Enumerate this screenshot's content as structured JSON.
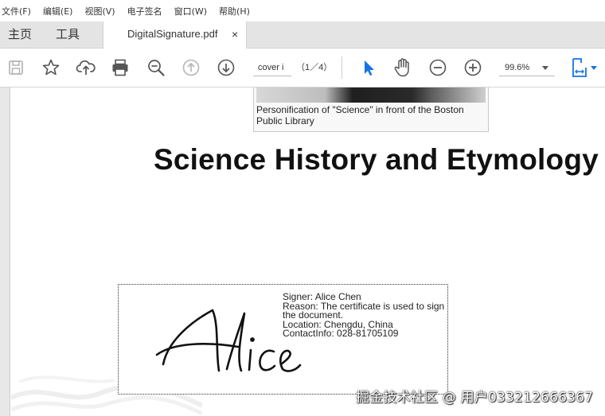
{
  "menu": {
    "items": [
      "文件(F)",
      "编辑(E)",
      "视图(V)",
      "电子签名",
      "窗口(W)",
      "帮助(H)"
    ]
  },
  "tabs": {
    "home": "主页",
    "tools": "工具",
    "document": "DigitalSignature.pdf",
    "close": "×"
  },
  "toolbar": {
    "icons": [
      "save-icon",
      "bookmark-star-icon",
      "cloud-upload-icon",
      "print-icon",
      "zoom-out-search-icon",
      "page-up-icon",
      "page-down-icon",
      "select-arrow-icon",
      "hand-tool-icon",
      "zoom-out-icon",
      "zoom-in-icon",
      "fit-page-icon"
    ],
    "page_input": "cover i",
    "page_count": "（1／4）",
    "zoom": "99.6%",
    "accent_color": "#1473e6"
  },
  "document": {
    "figure_caption": "Personification of \"Science\" in front of the Boston Public Library",
    "heading": "Science History and Etymology",
    "signature": {
      "signer": "Signer: Alice Chen",
      "reason": "Reason: The certificate is used to sign the document.",
      "location": "Location: Chengdu, China",
      "contact": "ContactInfo: 028-81705109",
      "handwritten": "Alice"
    }
  },
  "watermark": "掘金技术社区 @ 用户033212666367"
}
